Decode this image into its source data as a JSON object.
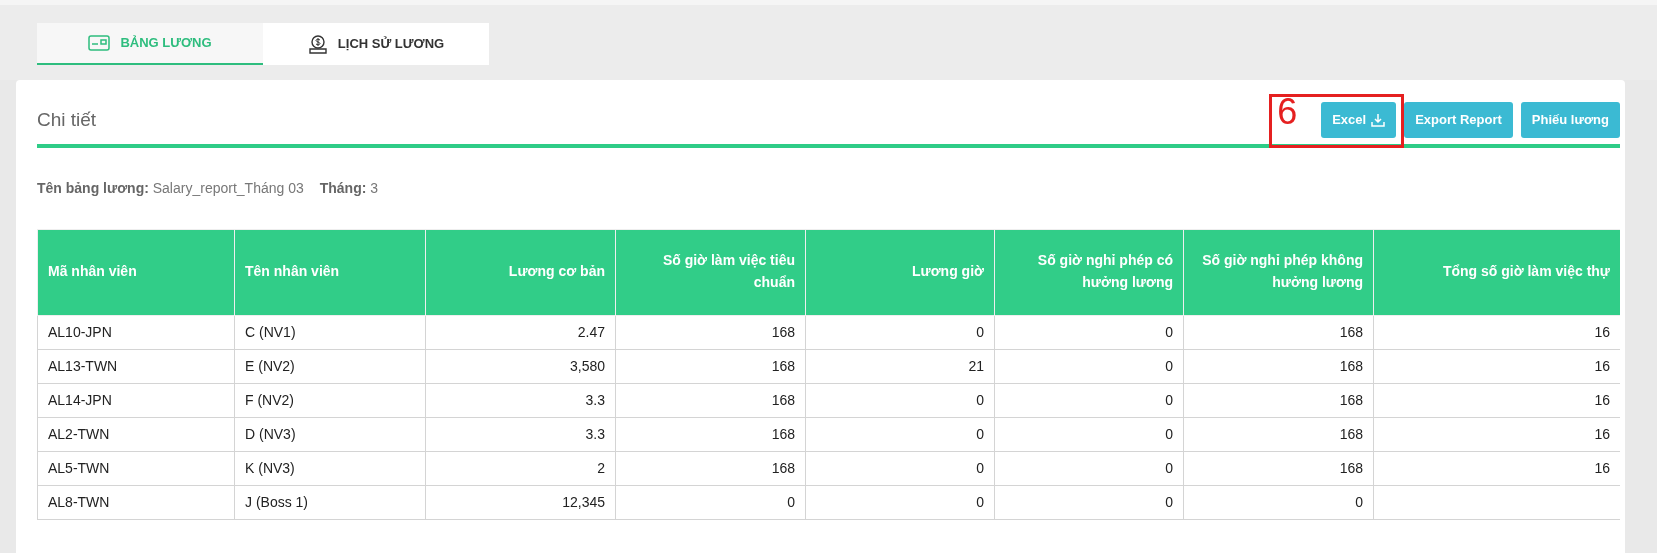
{
  "tabs": [
    {
      "label": "BẢNG LƯƠNG",
      "selected": true
    },
    {
      "label": "LỊCH SỬ LƯƠNG",
      "selected": false
    }
  ],
  "section": {
    "title": "Chi tiết"
  },
  "buttons": [
    {
      "label": "Excel",
      "annotation": "6"
    },
    {
      "label": "Export Report"
    },
    {
      "label": "Phiếu lương"
    }
  ],
  "info": [
    {
      "label": "Tên bảng lương:",
      "value": "Salary_report_Tháng 03"
    },
    {
      "label": "Tháng:",
      "value": "3"
    }
  ],
  "table": {
    "columns": [
      "Mã nhân viên",
      "Tên nhân viên",
      "Lương cơ bản",
      "Số giờ làm việc tiêu chuẩn",
      "Lương giờ",
      "Số giờ nghỉ phép có hưởng lương",
      "Số giờ nghỉ phép không hưởng lương",
      "Tổng số giờ làm việc thự"
    ],
    "rows": [
      [
        "AL10-JPN",
        "C (NV1)",
        "2.47",
        "168",
        "0",
        "0",
        "168",
        "16"
      ],
      [
        "AL13-TWN",
        "E (NV2)",
        "3,580",
        "168",
        "21",
        "0",
        "168",
        "16"
      ],
      [
        "AL14-JPN",
        "F (NV2)",
        "3.3",
        "168",
        "0",
        "0",
        "168",
        "16"
      ],
      [
        "AL2-TWN",
        "D (NV3)",
        "3.3",
        "168",
        "0",
        "0",
        "168",
        "16"
      ],
      [
        "AL5-TWN",
        "K (NV3)",
        "2",
        "168",
        "0",
        "0",
        "168",
        "16"
      ],
      [
        "AL8-TWN",
        "J (Boss 1)",
        "12,345",
        "0",
        "0",
        "0",
        "0",
        ""
      ]
    ]
  }
}
